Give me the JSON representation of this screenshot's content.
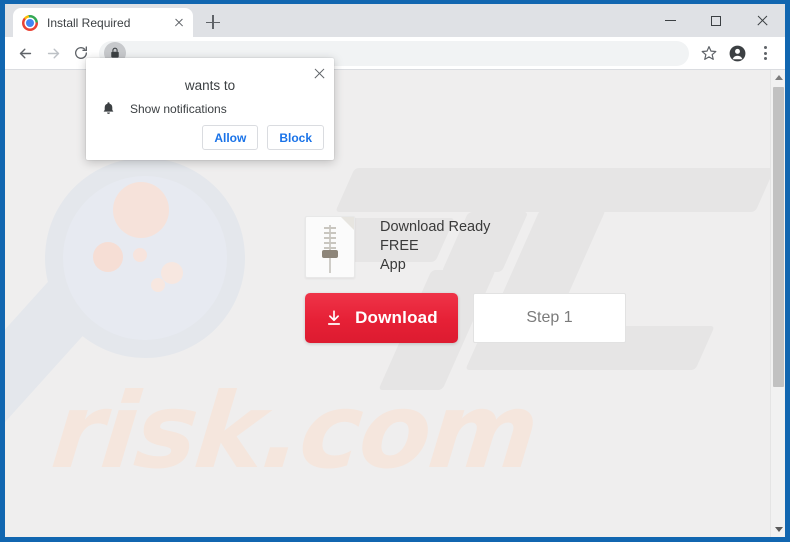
{
  "window": {
    "controls": {
      "minimize": "minimize",
      "maximize": "maximize",
      "close": "close"
    }
  },
  "tabstrip": {
    "tab": {
      "title": "Install Required",
      "favicon": "chrome-favicon",
      "close_label": "close-tab"
    },
    "new_tab_label": "new-tab"
  },
  "toolbar": {
    "back": "back-arrow",
    "forward": "forward-arrow",
    "reload": "reload-arrow",
    "address_value": "",
    "address_placeholder": "",
    "lock": "lock-icon",
    "bookmark": "star-icon",
    "profile": "profile-avatar",
    "menu": "three-dot-menu"
  },
  "permission_popup": {
    "title": "wants to",
    "permission_label": "Show notifications",
    "permission_icon": "bell-icon",
    "allow_label": "Allow",
    "block_label": "Block",
    "close_label": "close-popup"
  },
  "page": {
    "watermark_main": "PC",
    "watermark_text": "risk.com",
    "promo": {
      "file_icon": "zip-file-icon",
      "lines": [
        "Download Ready",
        "FREE",
        "App"
      ]
    },
    "download_button": {
      "label": "Download",
      "icon": "download-arrow-icon",
      "color": "#e62036"
    },
    "step_button": {
      "label": "Step 1"
    }
  },
  "scrollbar": {
    "up_label": "scroll-up",
    "down_label": "scroll-down",
    "thumb_label": "scroll-thumb"
  },
  "colors": {
    "frame_blue": "#1166b0",
    "tabstrip": "#dfe1e5",
    "page_bg": "#efeeee",
    "accent_red": "#e62036",
    "link_blue": "#1a73e8",
    "watermark_gray": "#e6e5e5",
    "watermark_peach": "#f5e6dd"
  }
}
